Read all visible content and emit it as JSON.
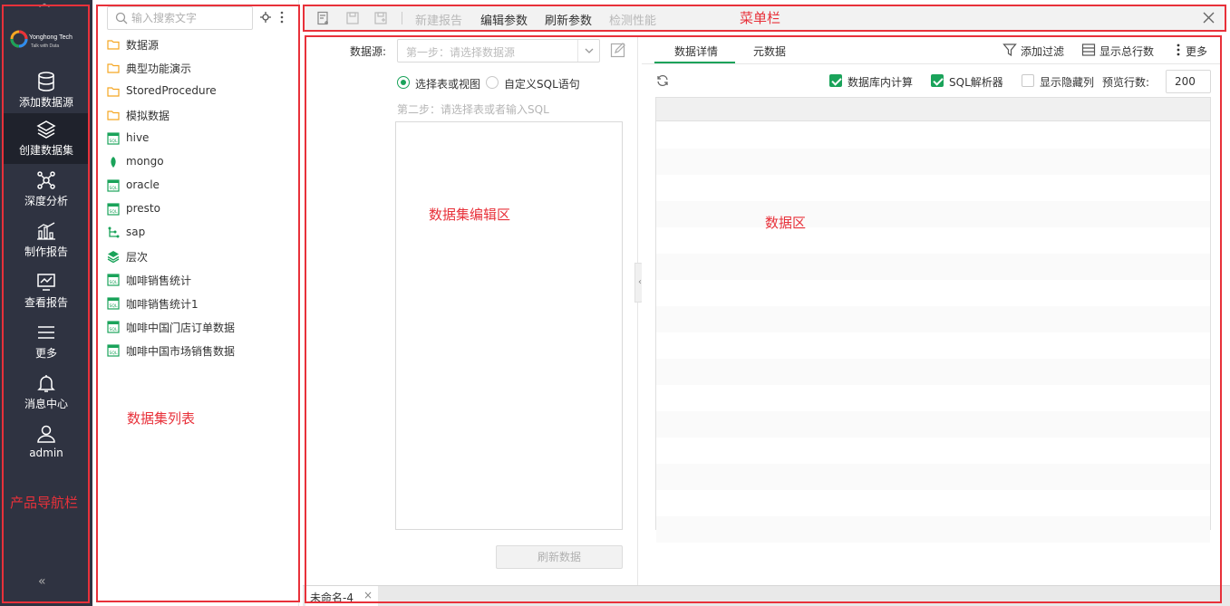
{
  "nav": {
    "logo_brand": "Yonghong Tech",
    "logo_tagline": "Talk with Data",
    "items": [
      {
        "label": "添加数据源",
        "icon": "database-icon"
      },
      {
        "label": "创建数据集",
        "icon": "layers-icon",
        "active": true
      },
      {
        "label": "深度分析",
        "icon": "network-icon"
      },
      {
        "label": "制作报告",
        "icon": "bar-chart-icon"
      },
      {
        "label": "查看报告",
        "icon": "line-chart-icon"
      },
      {
        "label": "更多",
        "icon": "menu-icon"
      },
      {
        "label": "消息中心",
        "icon": "bell-icon"
      },
      {
        "label": "admin",
        "icon": "user-icon"
      }
    ]
  },
  "list": {
    "search_placeholder": "输入搜索文字",
    "items": [
      {
        "label": "数据源",
        "icon": "folder-icon"
      },
      {
        "label": "典型功能演示",
        "icon": "folder-icon"
      },
      {
        "label": "StoredProcedure",
        "icon": "folder-icon"
      },
      {
        "label": "模拟数据",
        "icon": "folder-icon"
      },
      {
        "label": "hive",
        "icon": "sql-icon"
      },
      {
        "label": "mongo",
        "icon": "leaf-icon"
      },
      {
        "label": "oracle",
        "icon": "sql-icon"
      },
      {
        "label": "presto",
        "icon": "sql-icon"
      },
      {
        "label": "sap",
        "icon": "tree-icon"
      },
      {
        "label": "层次",
        "icon": "stack-icon"
      },
      {
        "label": "咖啡销售统计",
        "icon": "sql-icon"
      },
      {
        "label": "咖啡销售统计1",
        "icon": "sql-icon"
      },
      {
        "label": "咖啡中国门店订单数据",
        "icon": "sql-icon"
      },
      {
        "label": "咖啡中国市场销售数据",
        "icon": "sql-icon"
      }
    ]
  },
  "toolbar": {
    "new_report": "新建报告",
    "edit_params": "编辑参数",
    "refresh_params": "刷新参数",
    "check_performance": "检测性能"
  },
  "editor": {
    "datasource_label": "数据源:",
    "datasource_placeholder": "第一步：请选择数据源",
    "radio_table": "选择表或视图",
    "radio_sql": "自定义SQL语句",
    "step2": "第二步：请选择表或者输入SQL",
    "refresh_data": "刷新数据"
  },
  "data": {
    "tab_detail": "数据详情",
    "tab_meta": "元数据",
    "add_filter": "添加过滤",
    "show_total_rows": "显示总行数",
    "more": "更多",
    "cb_db_compute": "数据库内计算",
    "cb_sql_parser": "SQL解析器",
    "cb_show_hidden": "显示隐藏列",
    "preview_rows_label": "预览行数:",
    "preview_rows_value": "200"
  },
  "bottom_tab": {
    "label": "未命名-4"
  },
  "annotations": {
    "menu_bar": "菜单栏",
    "editor_area": "数据集编辑区",
    "data_area": "数据区",
    "dataset_list": "数据集列表",
    "nav_bar": "产品导航栏"
  },
  "colors": {
    "nav_bg": "#2f3341",
    "accent_green": "#1aa35a",
    "annotation_red": "#e8313a",
    "folder_orange": "#f5a623"
  }
}
